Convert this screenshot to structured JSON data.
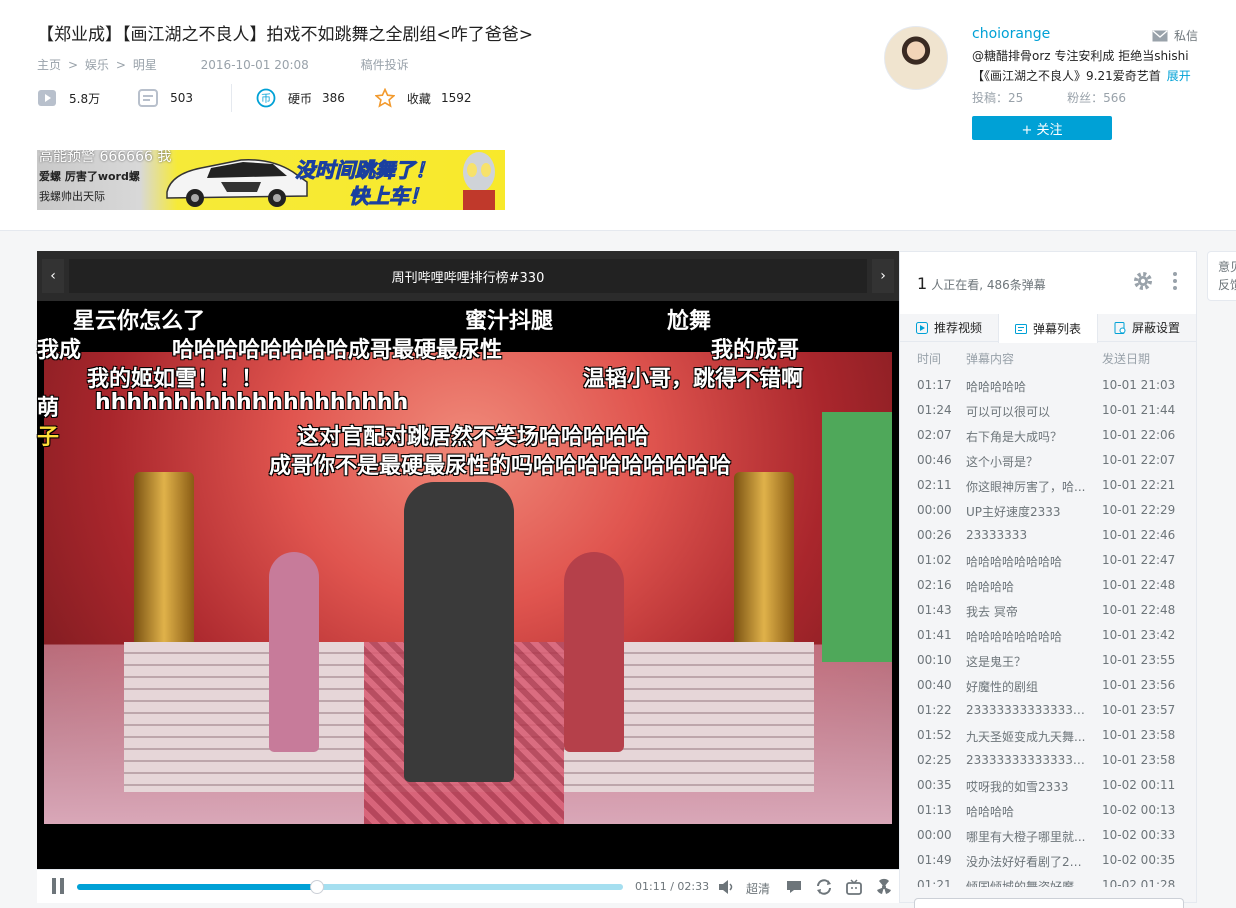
{
  "video": {
    "title": "【郑业成】【画江湖之不良人】拍戏不如跳舞之全剧组<咋了爸爸>",
    "breadcrumb": [
      "主页",
      "娱乐",
      "明星"
    ],
    "date": "2016-10-01 20:08",
    "submit_link": "稿件投诉",
    "plays": "5.8万",
    "danmaku_count": "503",
    "coin_label": "硬币",
    "coins": "386",
    "fav_label": "收藏",
    "favs": "1592"
  },
  "banner": {
    "left_text": [
      "高能预警 666666 我",
      "爱螺 厉害了word螺",
      "我螺帅出天际"
    ],
    "slogan1": "没时间跳舞了！",
    "slogan2": "快上车！"
  },
  "uploader": {
    "name": "choiorange",
    "message": "私信",
    "desc1": "@糖醋排骨orz 专注安利成 拒绝当shishi",
    "desc2": "【《画江湖之不良人》9.21爱奇艺首",
    "more": "展开",
    "posts": "投稿：25",
    "fans": "粉丝：566",
    "follow": "+ 关注"
  },
  "player": {
    "playlist_title": "周刊哔哩哔哩排行榜#330",
    "prev": "‹",
    "next": "›",
    "time": "01:11 / 02:33",
    "quality": "超清",
    "progress": 0.44,
    "buffered": 1.0,
    "danmaku": [
      {
        "text": "星云你怎么了"
      },
      {
        "text": "蜜汁抖腿"
      },
      {
        "text": "尬舞"
      },
      {
        "text": "我成"
      },
      {
        "text": "哈哈哈哈哈哈哈哈成哥最硬最尿性"
      },
      {
        "text": "我的成哥"
      },
      {
        "text": "我的姬如雪！！！"
      },
      {
        "text": "温韬小哥，跳得不错啊"
      },
      {
        "text": "萌"
      },
      {
        "text": "hhhhhhhhhhhhhhhhhhhh"
      },
      {
        "text": "子"
      },
      {
        "text": "这对官配对跳居然不笑场哈哈哈哈哈"
      },
      {
        "text": "成哥你不是最硬最尿性的吗哈哈哈哈哈哈哈哈哈"
      }
    ]
  },
  "sidebar": {
    "viewers_num": "1",
    "viewers_text": "人正在看, 486条弹幕",
    "tabs": [
      "推荐视频",
      "弹幕列表",
      "屏蔽设置"
    ],
    "columns": [
      "时间",
      "弹幕内容",
      "发送日期"
    ],
    "rows": [
      [
        "01:17",
        "哈哈哈哈哈",
        "10-01 21:03"
      ],
      [
        "01:24",
        "可以可以很可以",
        "10-01 21:44"
      ],
      [
        "02:07",
        "右下角是大成吗？",
        "10-01 22:06"
      ],
      [
        "00:46",
        "这个小哥是？",
        "10-01 22:07"
      ],
      [
        "02:11",
        "你这眼神厉害了，哈...",
        "10-01 22:21"
      ],
      [
        "00:00",
        "UP主好速度2333",
        "10-01 22:29"
      ],
      [
        "00:26",
        "23333333",
        "10-01 22:46"
      ],
      [
        "01:02",
        "哈哈哈哈哈哈哈哈",
        "10-01 22:47"
      ],
      [
        "02:16",
        "哈哈哈哈",
        "10-01 22:48"
      ],
      [
        "01:43",
        "我去 冥帝",
        "10-01 22:48"
      ],
      [
        "01:41",
        "哈哈哈哈哈哈哈哈",
        "10-01 23:42"
      ],
      [
        "00:10",
        "这是鬼王？",
        "10-01 23:55"
      ],
      [
        "00:40",
        "好魔性的剧组",
        "10-01 23:56"
      ],
      [
        "01:22",
        "2333333333333333...",
        "10-01 23:57"
      ],
      [
        "01:52",
        "九天圣姬变成九天舞...",
        "10-01 23:58"
      ],
      [
        "02:25",
        "2333333333333333...",
        "10-01 23:58"
      ],
      [
        "00:35",
        "哎呀我的如雪2333",
        "10-02 00:11"
      ],
      [
        "01:13",
        "哈哈哈哈",
        "10-02 00:13"
      ],
      [
        "00:00",
        "哪里有大橙子哪里就...",
        "10-02 00:33"
      ],
      [
        "01:49",
        "没办法好好看剧了23...",
        "10-02 00:35"
      ],
      [
        "01:21",
        "倾国倾城的舞姿好魔",
        "10-02 01:28"
      ]
    ]
  },
  "feedback": "意见反馈",
  "colors": {
    "accent": "#00a1d6",
    "coin": "#00a1d6",
    "star": "#f29a2e"
  }
}
